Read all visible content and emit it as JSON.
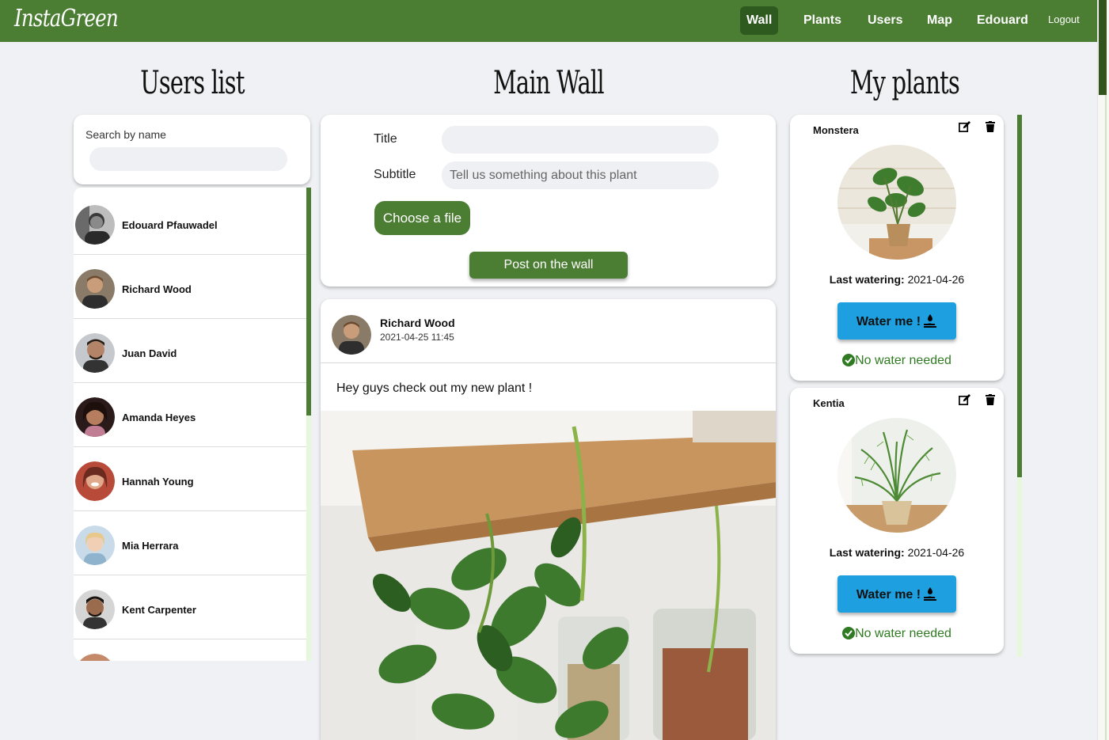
{
  "app": {
    "logo": "InstaGreen"
  },
  "nav": {
    "items": [
      {
        "label": "Wall",
        "active": true
      },
      {
        "label": "Plants"
      },
      {
        "label": "Users"
      },
      {
        "label": "Map"
      },
      {
        "label": "Edouard"
      }
    ],
    "logout": "Logout"
  },
  "users_panel": {
    "title": "Users list",
    "search_label": "Search by name",
    "search_value": "",
    "users": [
      {
        "name": "Edouard Pfauwadel"
      },
      {
        "name": "Richard Wood"
      },
      {
        "name": "Juan David"
      },
      {
        "name": "Amanda Heyes"
      },
      {
        "name": "Hannah Young"
      },
      {
        "name": "Mia Herrara"
      },
      {
        "name": "Kent Carpenter"
      },
      {
        "name": ""
      }
    ]
  },
  "wall": {
    "title": "Main Wall",
    "form": {
      "title_label": "Title",
      "title_value": "",
      "subtitle_label": "Subtitle",
      "subtitle_placeholder": "Tell us something about this plant",
      "choose_file": "Choose a file",
      "post_button": "Post on the wall"
    },
    "post": {
      "author": "Richard Wood",
      "date": "2021-04-25 11:45",
      "text": "Hey guys check out my new plant !"
    }
  },
  "plants_panel": {
    "title": "My plants",
    "plants": [
      {
        "name": "Monstera",
        "last_watering_label": "Last watering:",
        "last_watering": "2021-04-26",
        "water_button": "Water me !",
        "status": "No water needed"
      },
      {
        "name": "Kentia",
        "last_watering_label": "Last watering:",
        "last_watering": "2021-04-26",
        "water_button": "Water me !",
        "status": "No water needed"
      }
    ]
  },
  "colors": {
    "brand": "#4b7d33",
    "brand_dark": "#2f5a1f",
    "water": "#1ea0e0",
    "ok": "#2f7a22"
  }
}
